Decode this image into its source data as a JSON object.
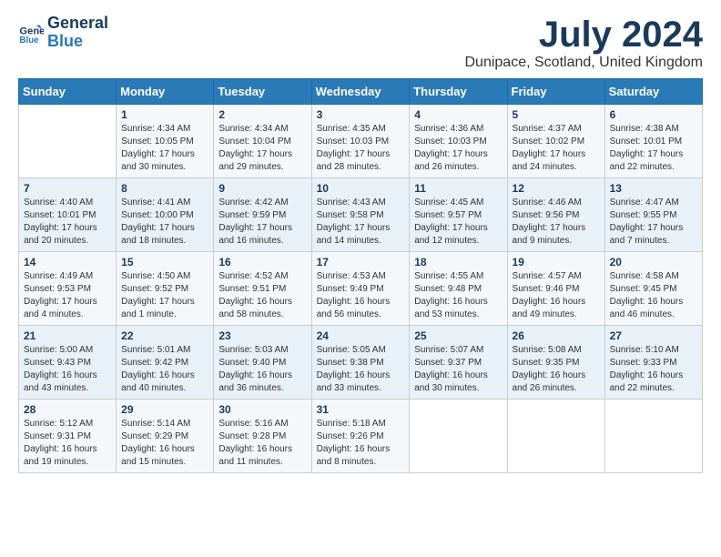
{
  "header": {
    "logo_line1": "General",
    "logo_line2": "Blue",
    "month_year": "July 2024",
    "location": "Dunipace, Scotland, United Kingdom"
  },
  "days_of_week": [
    "Sunday",
    "Monday",
    "Tuesday",
    "Wednesday",
    "Thursday",
    "Friday",
    "Saturday"
  ],
  "weeks": [
    [
      {
        "day": "",
        "info": ""
      },
      {
        "day": "1",
        "info": "Sunrise: 4:34 AM\nSunset: 10:05 PM\nDaylight: 17 hours\nand 30 minutes."
      },
      {
        "day": "2",
        "info": "Sunrise: 4:34 AM\nSunset: 10:04 PM\nDaylight: 17 hours\nand 29 minutes."
      },
      {
        "day": "3",
        "info": "Sunrise: 4:35 AM\nSunset: 10:03 PM\nDaylight: 17 hours\nand 28 minutes."
      },
      {
        "day": "4",
        "info": "Sunrise: 4:36 AM\nSunset: 10:03 PM\nDaylight: 17 hours\nand 26 minutes."
      },
      {
        "day": "5",
        "info": "Sunrise: 4:37 AM\nSunset: 10:02 PM\nDaylight: 17 hours\nand 24 minutes."
      },
      {
        "day": "6",
        "info": "Sunrise: 4:38 AM\nSunset: 10:01 PM\nDaylight: 17 hours\nand 22 minutes."
      }
    ],
    [
      {
        "day": "7",
        "info": "Sunrise: 4:40 AM\nSunset: 10:01 PM\nDaylight: 17 hours\nand 20 minutes."
      },
      {
        "day": "8",
        "info": "Sunrise: 4:41 AM\nSunset: 10:00 PM\nDaylight: 17 hours\nand 18 minutes."
      },
      {
        "day": "9",
        "info": "Sunrise: 4:42 AM\nSunset: 9:59 PM\nDaylight: 17 hours\nand 16 minutes."
      },
      {
        "day": "10",
        "info": "Sunrise: 4:43 AM\nSunset: 9:58 PM\nDaylight: 17 hours\nand 14 minutes."
      },
      {
        "day": "11",
        "info": "Sunrise: 4:45 AM\nSunset: 9:57 PM\nDaylight: 17 hours\nand 12 minutes."
      },
      {
        "day": "12",
        "info": "Sunrise: 4:46 AM\nSunset: 9:56 PM\nDaylight: 17 hours\nand 9 minutes."
      },
      {
        "day": "13",
        "info": "Sunrise: 4:47 AM\nSunset: 9:55 PM\nDaylight: 17 hours\nand 7 minutes."
      }
    ],
    [
      {
        "day": "14",
        "info": "Sunrise: 4:49 AM\nSunset: 9:53 PM\nDaylight: 17 hours\nand 4 minutes."
      },
      {
        "day": "15",
        "info": "Sunrise: 4:50 AM\nSunset: 9:52 PM\nDaylight: 17 hours\nand 1 minute."
      },
      {
        "day": "16",
        "info": "Sunrise: 4:52 AM\nSunset: 9:51 PM\nDaylight: 16 hours\nand 58 minutes."
      },
      {
        "day": "17",
        "info": "Sunrise: 4:53 AM\nSunset: 9:49 PM\nDaylight: 16 hours\nand 56 minutes."
      },
      {
        "day": "18",
        "info": "Sunrise: 4:55 AM\nSunset: 9:48 PM\nDaylight: 16 hours\nand 53 minutes."
      },
      {
        "day": "19",
        "info": "Sunrise: 4:57 AM\nSunset: 9:46 PM\nDaylight: 16 hours\nand 49 minutes."
      },
      {
        "day": "20",
        "info": "Sunrise: 4:58 AM\nSunset: 9:45 PM\nDaylight: 16 hours\nand 46 minutes."
      }
    ],
    [
      {
        "day": "21",
        "info": "Sunrise: 5:00 AM\nSunset: 9:43 PM\nDaylight: 16 hours\nand 43 minutes."
      },
      {
        "day": "22",
        "info": "Sunrise: 5:01 AM\nSunset: 9:42 PM\nDaylight: 16 hours\nand 40 minutes."
      },
      {
        "day": "23",
        "info": "Sunrise: 5:03 AM\nSunset: 9:40 PM\nDaylight: 16 hours\nand 36 minutes."
      },
      {
        "day": "24",
        "info": "Sunrise: 5:05 AM\nSunset: 9:38 PM\nDaylight: 16 hours\nand 33 minutes."
      },
      {
        "day": "25",
        "info": "Sunrise: 5:07 AM\nSunset: 9:37 PM\nDaylight: 16 hours\nand 30 minutes."
      },
      {
        "day": "26",
        "info": "Sunrise: 5:08 AM\nSunset: 9:35 PM\nDaylight: 16 hours\nand 26 minutes."
      },
      {
        "day": "27",
        "info": "Sunrise: 5:10 AM\nSunset: 9:33 PM\nDaylight: 16 hours\nand 22 minutes."
      }
    ],
    [
      {
        "day": "28",
        "info": "Sunrise: 5:12 AM\nSunset: 9:31 PM\nDaylight: 16 hours\nand 19 minutes."
      },
      {
        "day": "29",
        "info": "Sunrise: 5:14 AM\nSunset: 9:29 PM\nDaylight: 16 hours\nand 15 minutes."
      },
      {
        "day": "30",
        "info": "Sunrise: 5:16 AM\nSunset: 9:28 PM\nDaylight: 16 hours\nand 11 minutes."
      },
      {
        "day": "31",
        "info": "Sunrise: 5:18 AM\nSunset: 9:26 PM\nDaylight: 16 hours\nand 8 minutes."
      },
      {
        "day": "",
        "info": ""
      },
      {
        "day": "",
        "info": ""
      },
      {
        "day": "",
        "info": ""
      }
    ]
  ]
}
